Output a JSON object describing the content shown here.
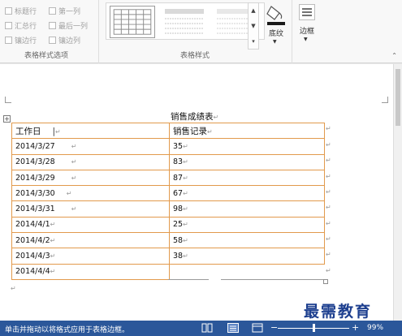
{
  "ribbon": {
    "options_group": {
      "label": "表格样式选项",
      "items": [
        {
          "label": "标题行",
          "checked": false
        },
        {
          "label": "第一列",
          "checked": false
        },
        {
          "label": "汇总行",
          "checked": false
        },
        {
          "label": "最后一列",
          "checked": false
        },
        {
          "label": "镶边行",
          "checked": false
        },
        {
          "label": "镶边列",
          "checked": false
        }
      ]
    },
    "styles_group": {
      "label": "表格样式",
      "gallery_count": 3,
      "selected_index": 0
    },
    "shading_label": "底纹",
    "borders_label": "边框"
  },
  "document": {
    "title": "销售成绩表",
    "table": {
      "headers": [
        "工作日",
        "销售记录"
      ],
      "rows": [
        [
          "2014/3/27",
          "35"
        ],
        [
          "2014/3/28",
          "83"
        ],
        [
          "2014/3/29",
          "87"
        ],
        [
          "2014/3/30",
          "67"
        ],
        [
          "2014/3/31",
          "98"
        ],
        [
          "2014/4/1",
          "25"
        ],
        [
          "2014/4/2",
          "58"
        ],
        [
          "2014/4/3",
          "38"
        ],
        [
          "2014/4/4",
          ""
        ]
      ]
    }
  },
  "status_bar": {
    "message": "单击并拖动以将格式应用于表格边框。",
    "zoom": "99%"
  },
  "watermark": "最需教育",
  "colors": {
    "table_border": "#e29a4c",
    "status_bar": "#2b579a",
    "watermark": "#1d3f8f"
  }
}
